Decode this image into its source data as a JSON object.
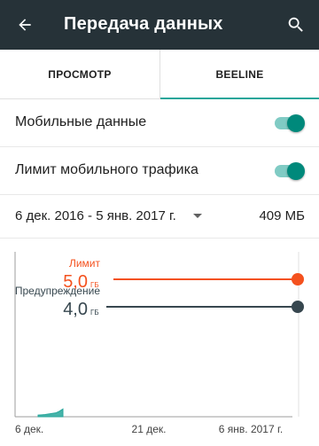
{
  "appbar": {
    "title": "Передача данных",
    "back_icon": "arrow-back-icon",
    "search_icon": "search-icon",
    "background_color": "#263238"
  },
  "tabs": [
    {
      "label": "ПРОСМОТР",
      "selected": false
    },
    {
      "label": "BEELINE",
      "selected": true
    }
  ],
  "settings": {
    "mobile_data": {
      "label": "Мобильные данные",
      "enabled": true
    },
    "mobile_limit": {
      "label": "Лимит мобильного трафика",
      "enabled": true
    }
  },
  "period": {
    "range": "6 дек. 2016 - 5 янв. 2017 г.",
    "usage": "409 МБ"
  },
  "accent_color": "#00897b",
  "chart_data": {
    "type": "area",
    "x_tick_labels": [
      "6 дек.",
      "21 дек.",
      "6 янв. 2017 г."
    ],
    "y_unit": "ГБ",
    "y_range": [
      0,
      6
    ],
    "x_range_days": [
      0,
      31
    ],
    "series": [
      {
        "x": [
          0,
          1,
          2,
          3,
          4,
          5,
          6,
          7
        ],
        "y": [
          0.06,
          0.07,
          0.08,
          0.1,
          0.12,
          0.14,
          0.2,
          0.28
        ],
        "color": "#26a69a"
      }
    ],
    "thresholds": [
      {
        "label": "Лимит",
        "value_text": "5,0",
        "unit": "ГБ",
        "value": 5.0,
        "color": "#f4511e"
      },
      {
        "label": "Предупреждение",
        "value_text": "4,0",
        "unit": "ГБ",
        "value": 4.0,
        "color": "#37474f"
      }
    ]
  }
}
